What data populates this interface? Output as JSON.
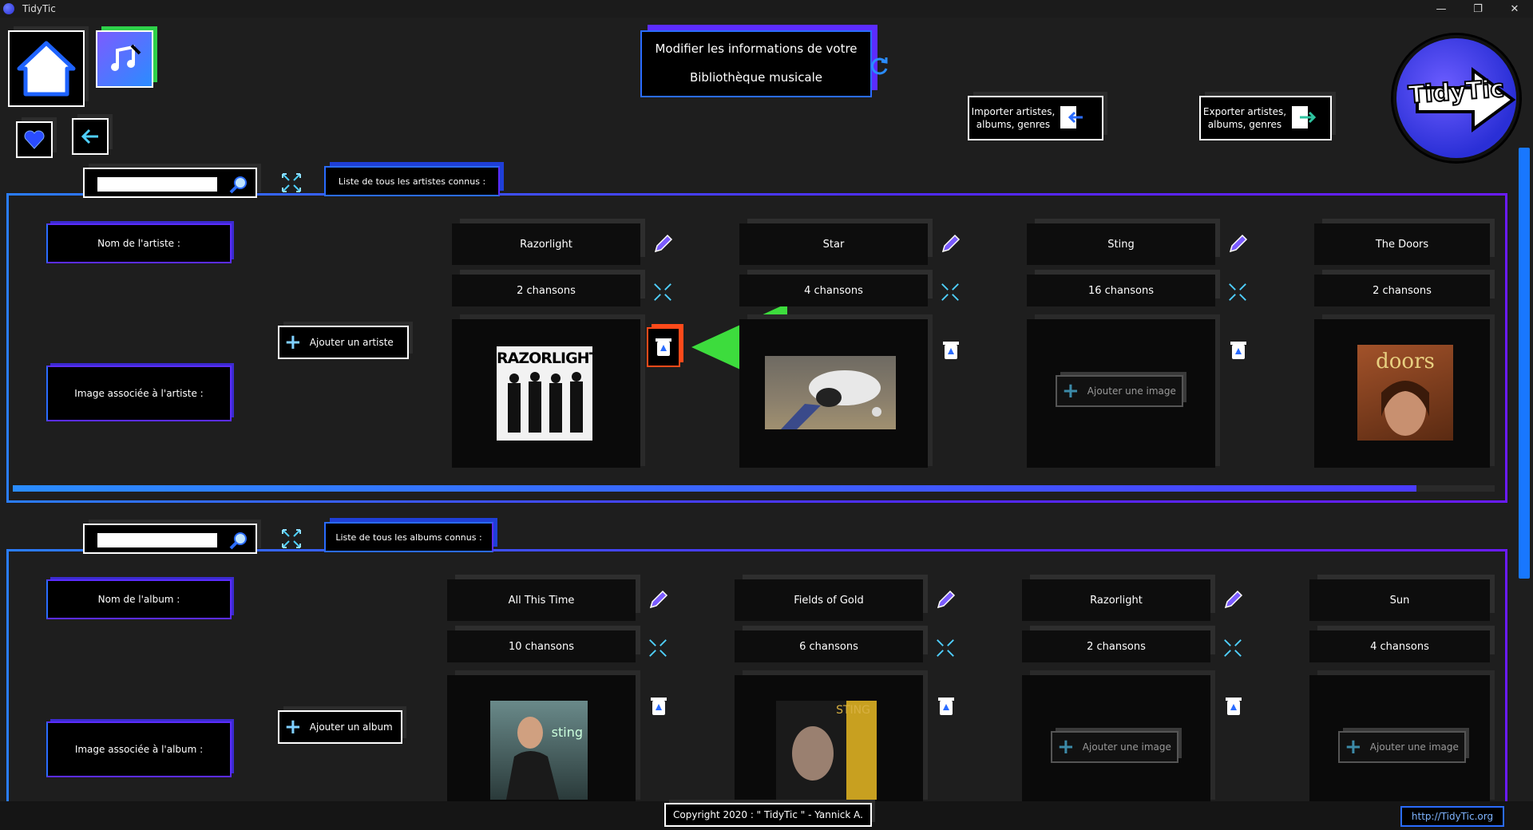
{
  "window": {
    "title": "TidyTic",
    "minimize": "—",
    "maximize": "❐",
    "close": "✕"
  },
  "header": {
    "title_line1": "Modifier les informations de votre",
    "title_line2": "Bibliothèque musicale",
    "import_label": "Importer artistes, albums, genres",
    "export_label": "Exporter artistes, albums, genres",
    "logo_text": "TidyTic"
  },
  "artists": {
    "search_placeholder": "",
    "list_title": "Liste de tous les artistes connus :",
    "name_label": "Nom de l'artiste :",
    "image_label": "Image associée à l'artiste :",
    "add_button": "Ajouter un artiste",
    "items": [
      {
        "name": "Razorlight",
        "songs": "2 chansons",
        "image": "RAZORLIGHT"
      },
      {
        "name": "Star",
        "songs": "4 chansons",
        "image": ""
      },
      {
        "name": "Sting",
        "songs": "16 chansons",
        "image": ""
      },
      {
        "name": "The Doors",
        "songs": "2 chansons",
        "image": "doors"
      }
    ]
  },
  "albums": {
    "search_placeholder": "",
    "list_title": "Liste de tous les albums connus :",
    "name_label": "Nom de l'album :",
    "image_label": "Image associée à l'album :",
    "add_button": "Ajouter un album",
    "items": [
      {
        "name": "All This Time",
        "songs": "10 chansons",
        "image": "sting"
      },
      {
        "name": "Fields of Gold",
        "songs": "6 chansons",
        "image": "STING"
      },
      {
        "name": "Razorlight",
        "songs": "2 chansons",
        "image": ""
      },
      {
        "name": "Sun",
        "songs": "4 chansons",
        "image": ""
      }
    ]
  },
  "add_image_label": "Ajouter une image",
  "footer": {
    "copyright": "Copyright 2020 : \" TidyTic \" - Yannick A.",
    "url": "http://TidyTic.org"
  },
  "colors": {
    "accent_blue": "#2a6cff",
    "accent_purple": "#5b2cff",
    "delete_active": "#ff4a1a",
    "arrow_green": "#3ddc3d"
  }
}
